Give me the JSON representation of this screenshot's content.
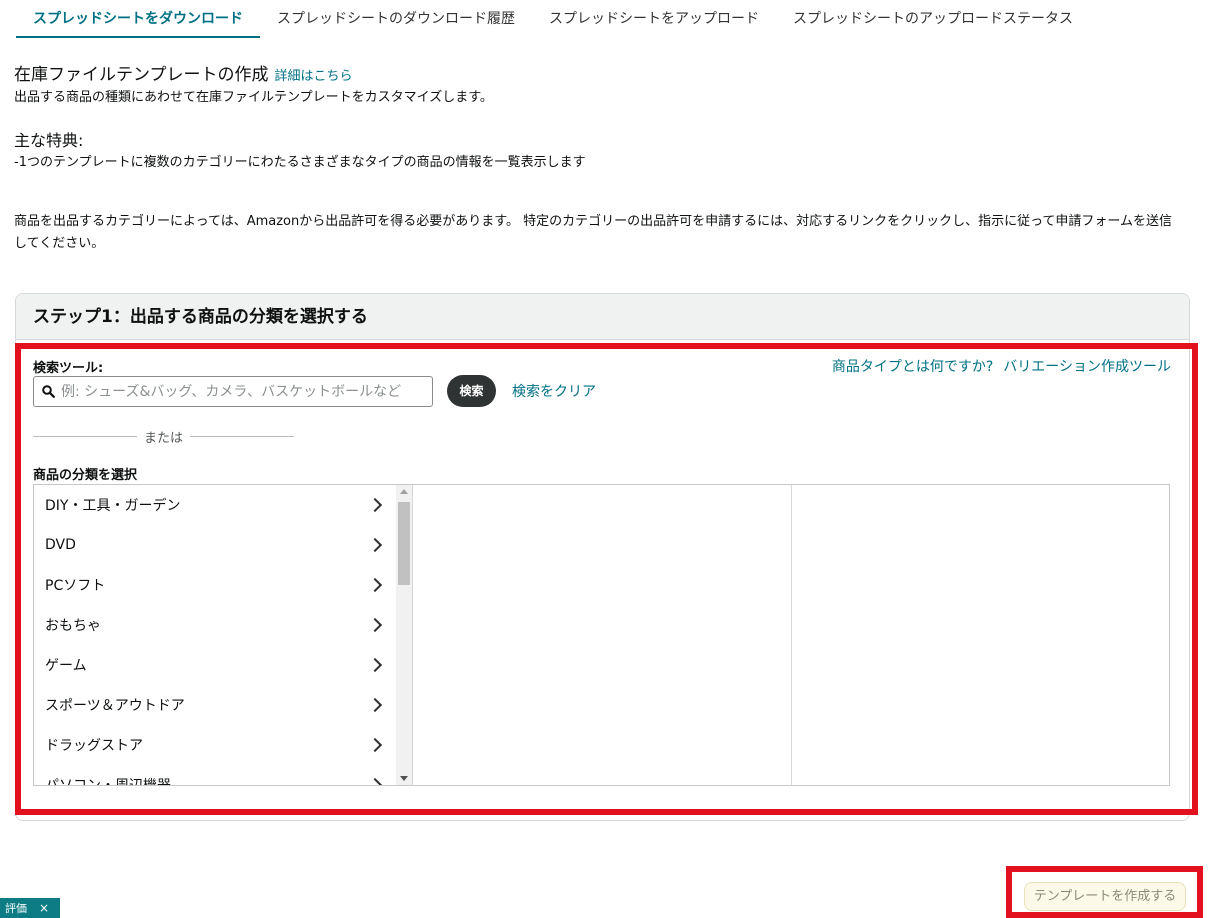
{
  "tabs": [
    {
      "label": "スプレッドシートをダウンロード",
      "active": true
    },
    {
      "label": "スプレッドシートのダウンロード履歴",
      "active": false
    },
    {
      "label": "スプレッドシートをアップロード",
      "active": false
    },
    {
      "label": "スプレッドシートのアップロードステータス",
      "active": false
    }
  ],
  "intro": {
    "title": "在庫ファイルテンプレートの作成",
    "details_link": "詳細はこちら",
    "description": "出品する商品の種類にあわせて在庫ファイルテンプレートをカスタマイズします。"
  },
  "features": {
    "title": "主な特典:",
    "item": "-1つのテンプレートに複数のカテゴリーにわたるさまざまなタイプの商品の情報を一覧表示します"
  },
  "notice": "商品を出品するカテゴリーによっては、Amazonから出品許可を得る必要があります。 特定のカテゴリーの出品許可を申請するには、対応するリンクをクリックし、指示に従って申請フォームを送信してください。",
  "step1": {
    "title": "ステップ1：出品する商品の分類を選択する",
    "search_label": "検索ツール:",
    "search_placeholder": "例: シューズ&バッグ、カメラ、バスケットボールなど",
    "search_button": "検索",
    "clear_link": "検索をクリア",
    "what_is_product_type_link": "商品タイプとは何ですか?",
    "variation_tool_link": "バリエーション作成ツール",
    "or_text": "または",
    "category_label": "商品の分類を選択",
    "categories": [
      "DIY・工具・ガーデン",
      "DVD",
      "PCソフト",
      "おもちゃ",
      "ゲーム",
      "スポーツ＆アウトドア",
      "ドラッグストア",
      "パソコン・周辺機器"
    ]
  },
  "create_template_button": "テンプレートを作成する",
  "feedback": {
    "label": "評価",
    "close": "×"
  },
  "colors": {
    "accent": "#007185",
    "highlight": "#e3101e",
    "header_bg": "#f0f2f2",
    "feedback_bg": "#0d7c85"
  }
}
